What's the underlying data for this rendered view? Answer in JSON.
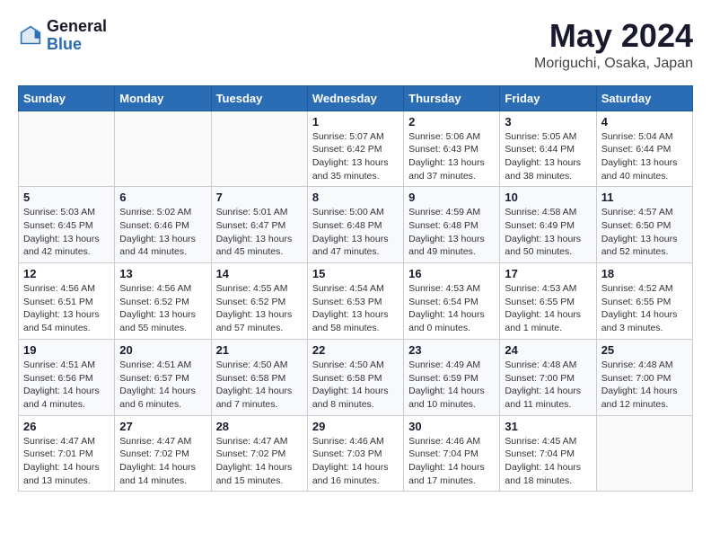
{
  "logo": {
    "general": "General",
    "blue": "Blue"
  },
  "title": "May 2024",
  "location": "Moriguchi, Osaka, Japan",
  "days_of_week": [
    "Sunday",
    "Monday",
    "Tuesday",
    "Wednesday",
    "Thursday",
    "Friday",
    "Saturday"
  ],
  "weeks": [
    [
      {
        "day": "",
        "info": ""
      },
      {
        "day": "",
        "info": ""
      },
      {
        "day": "",
        "info": ""
      },
      {
        "day": "1",
        "info": "Sunrise: 5:07 AM\nSunset: 6:42 PM\nDaylight: 13 hours\nand 35 minutes."
      },
      {
        "day": "2",
        "info": "Sunrise: 5:06 AM\nSunset: 6:43 PM\nDaylight: 13 hours\nand 37 minutes."
      },
      {
        "day": "3",
        "info": "Sunrise: 5:05 AM\nSunset: 6:44 PM\nDaylight: 13 hours\nand 38 minutes."
      },
      {
        "day": "4",
        "info": "Sunrise: 5:04 AM\nSunset: 6:44 PM\nDaylight: 13 hours\nand 40 minutes."
      }
    ],
    [
      {
        "day": "5",
        "info": "Sunrise: 5:03 AM\nSunset: 6:45 PM\nDaylight: 13 hours\nand 42 minutes."
      },
      {
        "day": "6",
        "info": "Sunrise: 5:02 AM\nSunset: 6:46 PM\nDaylight: 13 hours\nand 44 minutes."
      },
      {
        "day": "7",
        "info": "Sunrise: 5:01 AM\nSunset: 6:47 PM\nDaylight: 13 hours\nand 45 minutes."
      },
      {
        "day": "8",
        "info": "Sunrise: 5:00 AM\nSunset: 6:48 PM\nDaylight: 13 hours\nand 47 minutes."
      },
      {
        "day": "9",
        "info": "Sunrise: 4:59 AM\nSunset: 6:48 PM\nDaylight: 13 hours\nand 49 minutes."
      },
      {
        "day": "10",
        "info": "Sunrise: 4:58 AM\nSunset: 6:49 PM\nDaylight: 13 hours\nand 50 minutes."
      },
      {
        "day": "11",
        "info": "Sunrise: 4:57 AM\nSunset: 6:50 PM\nDaylight: 13 hours\nand 52 minutes."
      }
    ],
    [
      {
        "day": "12",
        "info": "Sunrise: 4:56 AM\nSunset: 6:51 PM\nDaylight: 13 hours\nand 54 minutes."
      },
      {
        "day": "13",
        "info": "Sunrise: 4:56 AM\nSunset: 6:52 PM\nDaylight: 13 hours\nand 55 minutes."
      },
      {
        "day": "14",
        "info": "Sunrise: 4:55 AM\nSunset: 6:52 PM\nDaylight: 13 hours\nand 57 minutes."
      },
      {
        "day": "15",
        "info": "Sunrise: 4:54 AM\nSunset: 6:53 PM\nDaylight: 13 hours\nand 58 minutes."
      },
      {
        "day": "16",
        "info": "Sunrise: 4:53 AM\nSunset: 6:54 PM\nDaylight: 14 hours\nand 0 minutes."
      },
      {
        "day": "17",
        "info": "Sunrise: 4:53 AM\nSunset: 6:55 PM\nDaylight: 14 hours\nand 1 minute."
      },
      {
        "day": "18",
        "info": "Sunrise: 4:52 AM\nSunset: 6:55 PM\nDaylight: 14 hours\nand 3 minutes."
      }
    ],
    [
      {
        "day": "19",
        "info": "Sunrise: 4:51 AM\nSunset: 6:56 PM\nDaylight: 14 hours\nand 4 minutes."
      },
      {
        "day": "20",
        "info": "Sunrise: 4:51 AM\nSunset: 6:57 PM\nDaylight: 14 hours\nand 6 minutes."
      },
      {
        "day": "21",
        "info": "Sunrise: 4:50 AM\nSunset: 6:58 PM\nDaylight: 14 hours\nand 7 minutes."
      },
      {
        "day": "22",
        "info": "Sunrise: 4:50 AM\nSunset: 6:58 PM\nDaylight: 14 hours\nand 8 minutes."
      },
      {
        "day": "23",
        "info": "Sunrise: 4:49 AM\nSunset: 6:59 PM\nDaylight: 14 hours\nand 10 minutes."
      },
      {
        "day": "24",
        "info": "Sunrise: 4:48 AM\nSunset: 7:00 PM\nDaylight: 14 hours\nand 11 minutes."
      },
      {
        "day": "25",
        "info": "Sunrise: 4:48 AM\nSunset: 7:00 PM\nDaylight: 14 hours\nand 12 minutes."
      }
    ],
    [
      {
        "day": "26",
        "info": "Sunrise: 4:47 AM\nSunset: 7:01 PM\nDaylight: 14 hours\nand 13 minutes."
      },
      {
        "day": "27",
        "info": "Sunrise: 4:47 AM\nSunset: 7:02 PM\nDaylight: 14 hours\nand 14 minutes."
      },
      {
        "day": "28",
        "info": "Sunrise: 4:47 AM\nSunset: 7:02 PM\nDaylight: 14 hours\nand 15 minutes."
      },
      {
        "day": "29",
        "info": "Sunrise: 4:46 AM\nSunset: 7:03 PM\nDaylight: 14 hours\nand 16 minutes."
      },
      {
        "day": "30",
        "info": "Sunrise: 4:46 AM\nSunset: 7:04 PM\nDaylight: 14 hours\nand 17 minutes."
      },
      {
        "day": "31",
        "info": "Sunrise: 4:45 AM\nSunset: 7:04 PM\nDaylight: 14 hours\nand 18 minutes."
      },
      {
        "day": "",
        "info": ""
      }
    ]
  ]
}
